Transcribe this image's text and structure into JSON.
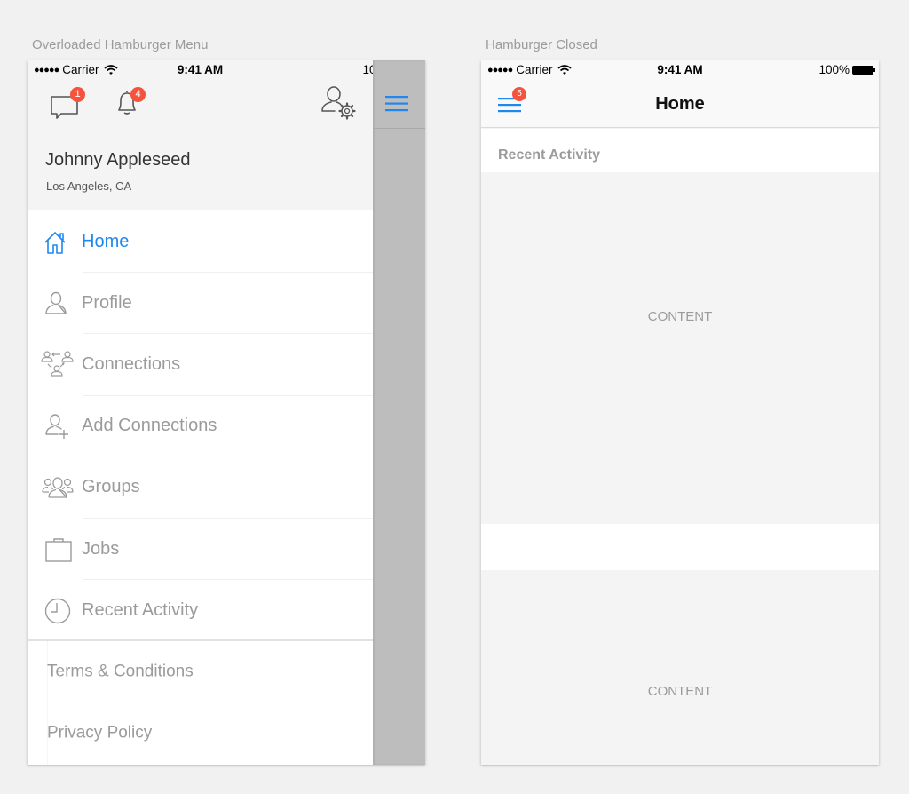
{
  "artboards": {
    "left_label": "Overloaded Hamburger Menu",
    "right_label": "Hamburger Closed"
  },
  "status_bar": {
    "signal": "●●●●●",
    "carrier": "Carrier",
    "time": "9:41 AM",
    "battery": "100%"
  },
  "drawer": {
    "header_icons": [
      {
        "icon": "chat-bubble-icon",
        "badge": "1"
      },
      {
        "icon": "bell-icon",
        "badge": "4"
      },
      {
        "icon": "user-settings-icon"
      }
    ],
    "user": {
      "name": "Johnny Appleseed",
      "location": "Los Angeles, CA"
    },
    "menu_items": [
      {
        "label": "Home",
        "icon": "home-icon",
        "active": true
      },
      {
        "label": "Profile",
        "icon": "profile-icon"
      },
      {
        "label": "Connections",
        "icon": "connections-icon"
      },
      {
        "label": "Add Connections",
        "icon": "add-user-icon"
      },
      {
        "label": "Groups",
        "icon": "groups-icon"
      },
      {
        "label": "Jobs",
        "icon": "briefcase-icon"
      },
      {
        "label": "Recent Activity",
        "icon": "clock-icon"
      }
    ],
    "footer_items": [
      {
        "label": "Terms & Conditions"
      },
      {
        "label": "Privacy Policy"
      }
    ]
  },
  "closed_screen": {
    "hamburger_badge": "5",
    "title": "Home",
    "section_header": "Recent Activity",
    "content_blocks": [
      "CONTENT",
      "CONTENT"
    ]
  },
  "colors": {
    "accent": "#1e88f0",
    "badge": "#f5533d",
    "muted_text": "#9b9b9b",
    "overlay": "#bdbdbd"
  }
}
